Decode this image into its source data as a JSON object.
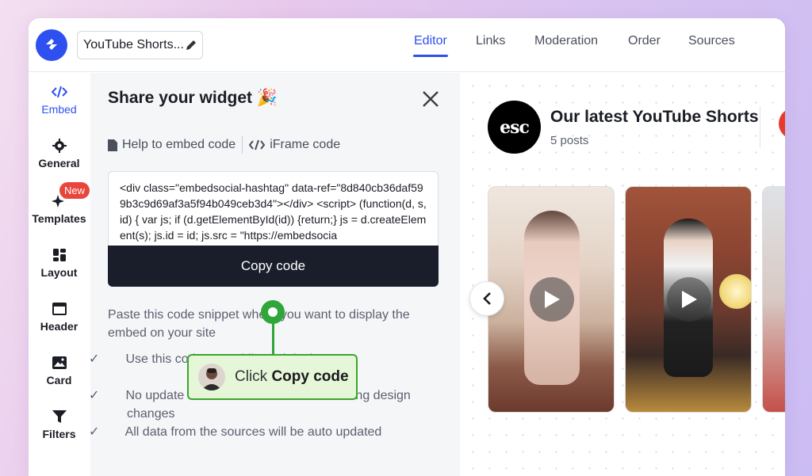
{
  "header": {
    "widget_title": "YouTube Shorts...",
    "tabs": [
      {
        "label": "Editor",
        "active": true
      },
      {
        "label": "Links"
      },
      {
        "label": "Moderation"
      },
      {
        "label": "Order"
      },
      {
        "label": "Sources"
      }
    ]
  },
  "sidebar": {
    "items": [
      {
        "label": "Embed",
        "icon": "code-icon",
        "active": true
      },
      {
        "label": "General",
        "icon": "gear-icon"
      },
      {
        "label": "Templates",
        "icon": "sparkle-icon",
        "badge": "New"
      },
      {
        "label": "Layout",
        "icon": "layout-icon"
      },
      {
        "label": "Header",
        "icon": "header-icon"
      },
      {
        "label": "Card",
        "icon": "image-icon"
      },
      {
        "label": "Filters",
        "icon": "filter-icon"
      }
    ]
  },
  "share_panel": {
    "title": "Share your widget",
    "title_emoji": "🎉",
    "help_link": "Help to embed code",
    "iframe_link": "iFrame code",
    "code_snippet": "<div class=\"embedsocial-hashtag\" data-ref=\"8d840cb36daf599b3c9d69af3a5f94b049ceb3d4\"></div> <script> (function(d, s, id) { var js; if (d.getElementById(id)) {return;} js = d.createElement(s); js.id = id; js.src = \"https://embedsocia",
    "copy_button": "Copy code",
    "description": "Paste this code snippet where you want to display the embed on your site",
    "checks": [
      "Use this code on mobile and desktop",
      "No update of the code needed after making design changes",
      "All data from the sources will be auto updated"
    ]
  },
  "tooltip": {
    "prefix": "Click",
    "bold": "Copy code"
  },
  "preview": {
    "logo_text": "esc",
    "title": "Our latest YouTube Shorts",
    "subtitle": "5 posts"
  },
  "colors": {
    "accent": "#2e50f0",
    "dark_button": "#1a1e2b",
    "tooltip_green": "#3ca52b",
    "badge_red": "#e8453c"
  }
}
